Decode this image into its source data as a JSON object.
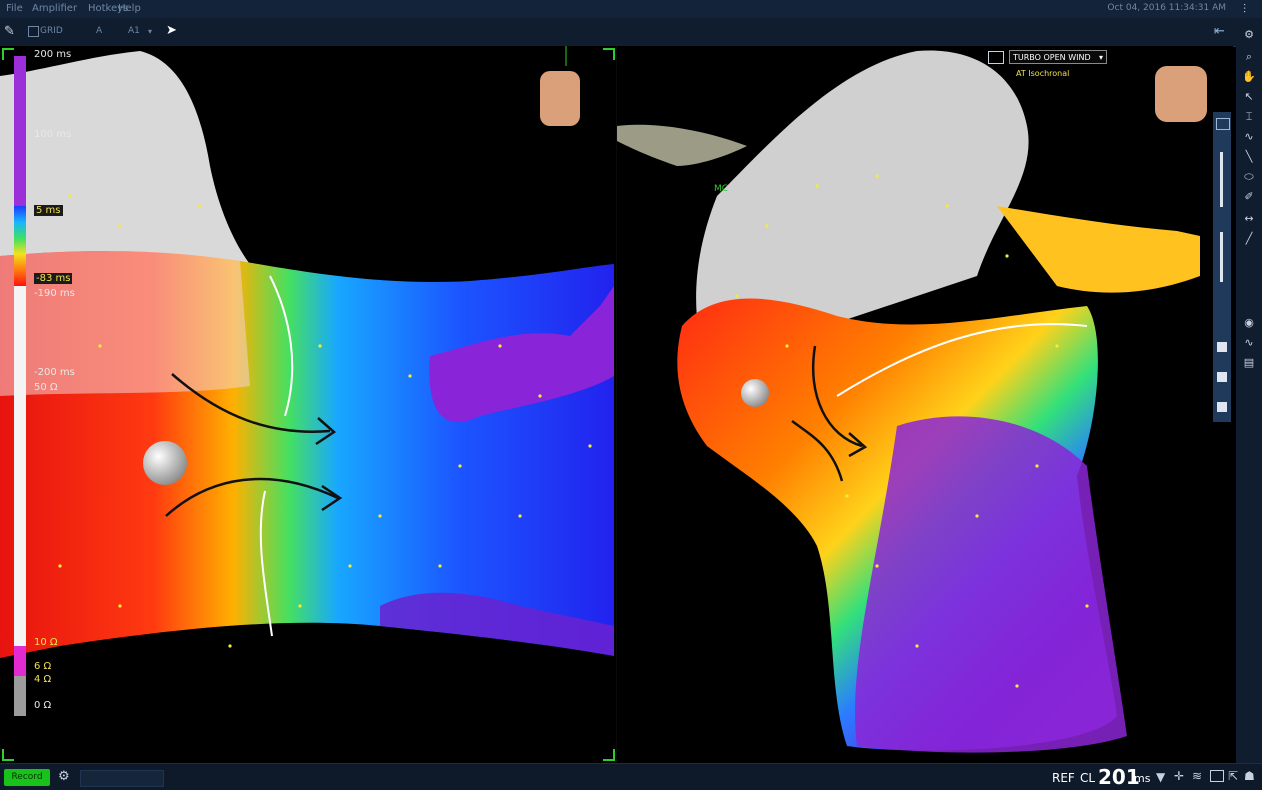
{
  "menu": {
    "items": [
      "File",
      "Amplifier",
      "Hotkeys",
      "Help"
    ],
    "datetime": "Oct 04, 2016 11:34:31 AM"
  },
  "toolbar": {
    "grid_label": "GRID",
    "a_label": "A",
    "a1_label": "A1"
  },
  "scale": {
    "labels_time": [
      "200 ms",
      "100 ms",
      "5 ms",
      "-83 ms",
      "-190 ms",
      "-200 ms"
    ],
    "labels_ohm": [
      "50 Ω",
      "10 Ω",
      "6 Ω",
      "4 Ω",
      "0 Ω"
    ]
  },
  "view": {
    "dropdown_label": "TURBO OPEN WIND",
    "map_type": "AT Isochronal",
    "marker_label": "MC"
  },
  "status": {
    "record_label": "Record",
    "ref_label": "REF",
    "cl_label": "CL",
    "cl_value": "201",
    "cl_unit": "ms"
  },
  "colors": {
    "accent_green": "#18c21a",
    "toolbar_bg": "#0f1d2f",
    "scale_purple": "#9b30d8"
  }
}
